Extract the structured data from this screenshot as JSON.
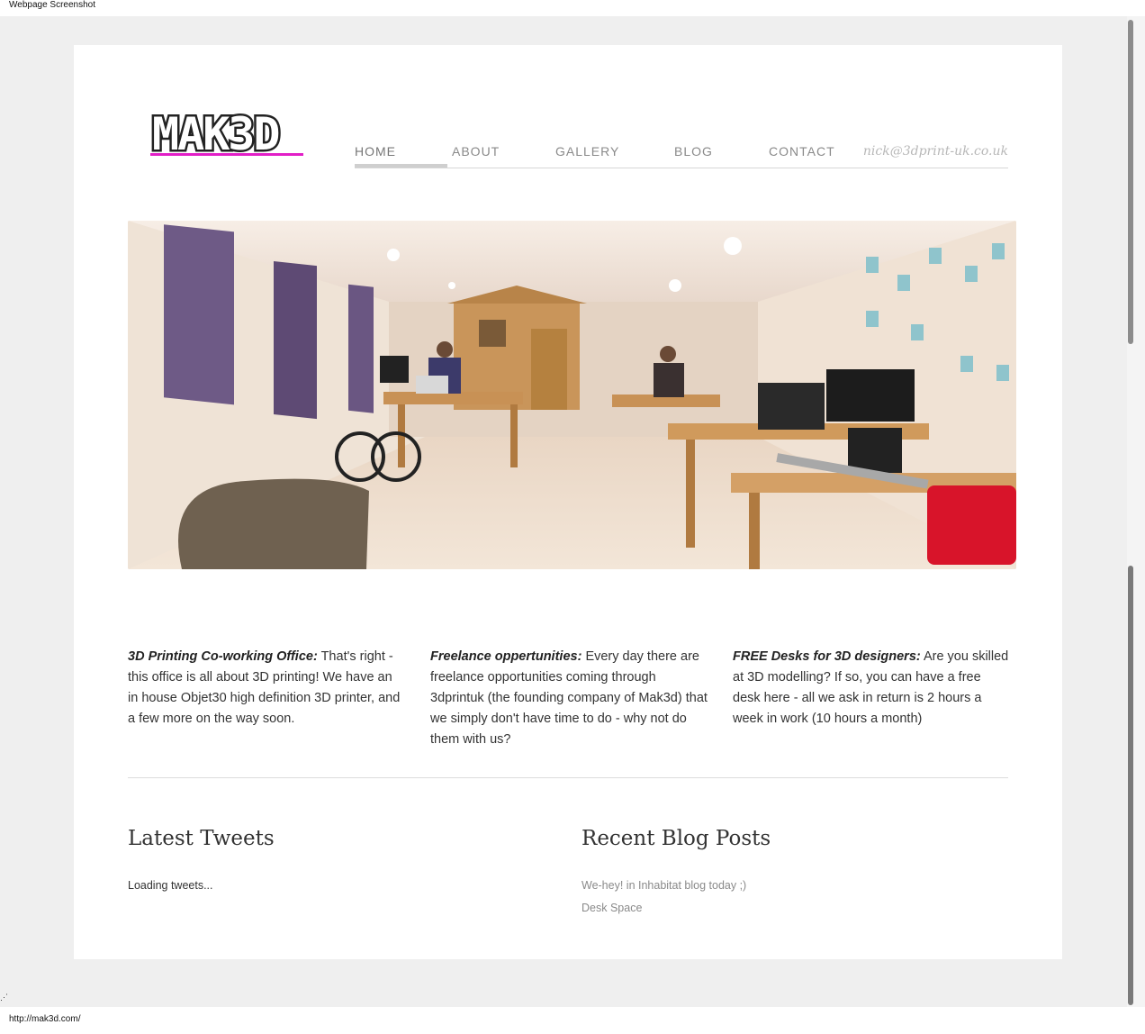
{
  "window": {
    "caption": "Webpage Screenshot",
    "status_url": "http://mak3d.com/"
  },
  "logo": {
    "text": "MAK3D",
    "brand_color": "#222222",
    "accent_color": "#e21ec7"
  },
  "nav": {
    "items": [
      {
        "label": "HOME",
        "active": true
      },
      {
        "label": "ABOUT"
      },
      {
        "label": "GALLERY"
      },
      {
        "label": "BLOG"
      },
      {
        "label": "CONTACT"
      }
    ],
    "email": "nick@3dprint-uk.co.uk"
  },
  "features": [
    {
      "heading": "3D Printing Co-working Office:",
      "body": "That's right - this office is all about 3D printing! We have an in house Objet30 high definition 3D printer, and a few more on the way soon."
    },
    {
      "heading": "Freelance oppertunities:",
      "body": "Every day there are freelance opportunities coming through 3dprintuk (the founding company of Mak3d) that we simply don't have time to do - why not do them with us?"
    },
    {
      "heading": "FREE Desks for 3D designers:",
      "body": "Are you skilled at 3D modelling? If so, you can have a free desk here - all we ask in return is 2 hours a week in work (10 hours a month)"
    }
  ],
  "tweets": {
    "title": "Latest Tweets",
    "status": "Loading tweets..."
  },
  "blog": {
    "title": "Recent Blog Posts",
    "posts": [
      "We-hey! in Inhabitat blog today ;)",
      "Desk Space"
    ]
  }
}
